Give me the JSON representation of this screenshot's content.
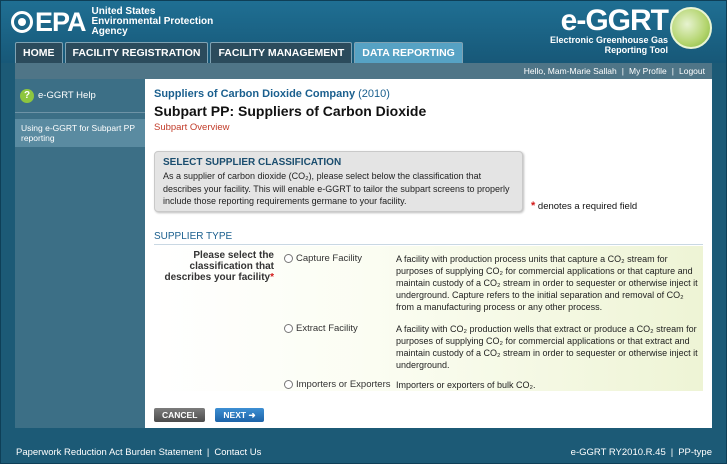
{
  "header": {
    "epa_mark": "EPA",
    "epa_lines": [
      "United States",
      "Environmental Protection",
      "Agency"
    ],
    "tool_title": "e-GGRT",
    "tool_sub": [
      "Electronic Greenhouse Gas",
      "Reporting Tool"
    ]
  },
  "nav": {
    "tabs": [
      {
        "label": "HOME"
      },
      {
        "label": "FACILITY REGISTRATION"
      },
      {
        "label": "FACILITY MANAGEMENT"
      },
      {
        "label": "DATA REPORTING"
      }
    ],
    "active": "DATA REPORTING"
  },
  "userbar": {
    "greeting": "Hello, Mam-Marie Sallah",
    "profile": "My Profile",
    "logout": "Logout"
  },
  "sidebar": {
    "help_label": "e-GGRT Help",
    "help_link": "Using e-GGRT for Subpart PP reporting"
  },
  "main": {
    "company": "Suppliers of Carbon Dioxide Company",
    "year": "(2010)",
    "title": "Subpart PP: Suppliers of Carbon Dioxide",
    "overview": "Subpart Overview",
    "callout_title": "SELECT SUPPLIER CLASSIFICATION",
    "callout_body": "As a supplier of carbon dioxide (CO₂), please select below the classification that describes your facility. This will enable e-GGRT to tailor the subpart screens to properly include those reporting requirements germane to your facility.",
    "required_note": "denotes a required field",
    "section_label": "SUPPLIER TYPE",
    "question": "Please select the classification that describes your facility",
    "options": [
      {
        "label": "Capture Facility",
        "desc": "A facility with production process units that capture a CO₂ stream for purposes of supplying CO₂ for commercial applications or that capture and maintain custody of a CO₂ stream in order to sequester or otherwise inject it underground. Capture refers to the initial separation and removal of CO₂ from a manufacturing process or any other process."
      },
      {
        "label": "Extract Facility",
        "desc": "A facility with CO₂ production wells that extract or produce a CO₂ stream for purposes of supplying CO₂ for commercial applications or that extract and maintain custody of a CO₂ stream in order to sequester or otherwise inject it underground."
      },
      {
        "label": "Importers or Exporters",
        "desc": "Importers or exporters of bulk CO₂."
      }
    ],
    "cancel": "CANCEL",
    "next": "NEXT"
  },
  "footer": {
    "paperwork": "Paperwork Reduction Act Burden Statement",
    "contact": "Contact Us",
    "version": "e-GGRT RY2010.R.45",
    "type": "PP-type"
  }
}
